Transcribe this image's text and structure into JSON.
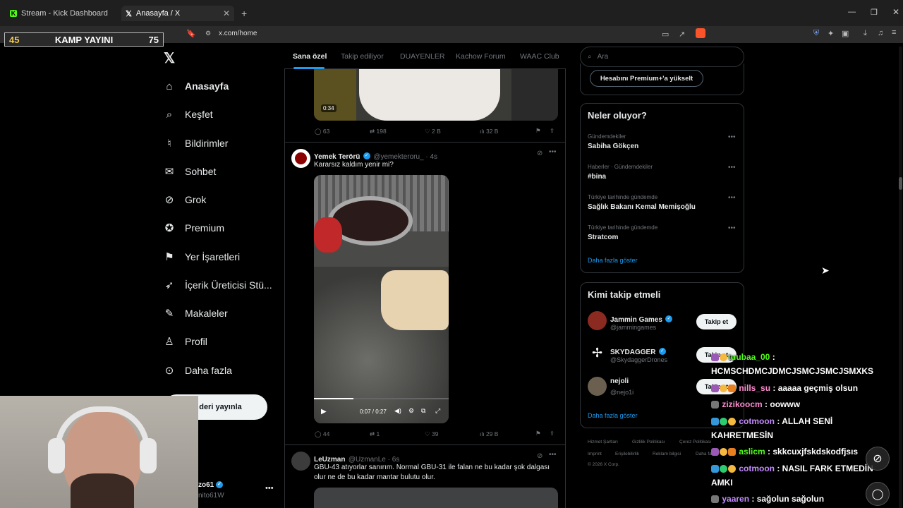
{
  "browser": {
    "tabs": [
      {
        "label": "Stream - Kick Dashboard",
        "active": false
      },
      {
        "label": "Anasayfa / X",
        "active": true
      }
    ],
    "url": "x.com/home"
  },
  "overlay": {
    "left_num": "45",
    "title": "KAMP YAYINI",
    "right_num": "75"
  },
  "sidebar": {
    "items": [
      {
        "label": "Anasayfa",
        "icon": "home-icon"
      },
      {
        "label": "Keşfet",
        "icon": "search-icon"
      },
      {
        "label": "Bildirimler",
        "icon": "bell-icon"
      },
      {
        "label": "Sohbet",
        "icon": "mail-icon"
      },
      {
        "label": "Grok",
        "icon": "grok-icon"
      },
      {
        "label": "Premium",
        "icon": "premium-icon"
      },
      {
        "label": "Yer İşaretleri",
        "icon": "bookmark-icon"
      },
      {
        "label": "İçerik Üreticisi Stü...",
        "icon": "rocket-icon"
      },
      {
        "label": "Makaleler",
        "icon": "article-icon"
      },
      {
        "label": "Profil",
        "icon": "profile-icon"
      },
      {
        "label": "Daha fazla",
        "icon": "more-icon"
      }
    ],
    "post_button": "deri yayınla",
    "account_name": "zo61",
    "account_handle": "nito61W"
  },
  "feed": {
    "tabs": [
      "Sana özel",
      "Takip ediliyor",
      "DUAYENLER",
      "Kachow Forum",
      "WAAC Club"
    ],
    "post0": {
      "duration": "0:34",
      "replies": "63",
      "reposts": "198",
      "likes": "2 B",
      "views": "32 B"
    },
    "post1": {
      "name": "Yemek Terörü",
      "handle": "@yemekteroru_ · 4s",
      "text": "Kararsız kaldım yenir mi?",
      "time": "0:07 / 0:27",
      "replies": "44",
      "reposts": "1",
      "likes": "39",
      "views": "29 B"
    },
    "post2": {
      "name": "LeUzman",
      "handle": "@UzmanLe · 6s",
      "text": "GBU-43 atıyorlar sanırım. Normal GBU-31 ile falan ne bu kadar şok dalgası olur ne de bu kadar mantar bulutu olur."
    }
  },
  "right": {
    "search_placeholder": "Ara",
    "premium_button": "Hesabını Premium+'a yükselt",
    "trends_title": "Neler oluyor?",
    "trends": [
      {
        "context": "Gündemdekiler",
        "name": "Sabiha Gökçen"
      },
      {
        "context": "Haberler · Gündemdekiler",
        "name": "#bina"
      },
      {
        "context": "Türkiye tarihinde gündemde",
        "name": "Sağlık Bakanı Kemal Memişoğlu"
      },
      {
        "context": "Türkiye tarihinde gündemde",
        "name": "Stratcom"
      }
    ],
    "show_more": "Daha fazla göster",
    "wtf_title": "Kimi takip etmeli",
    "wtf": [
      {
        "name": "Jammin Games",
        "handle": "@jammingames",
        "button": "Takip et"
      },
      {
        "name": "SKYDAGGER",
        "handle": "@SkydaggerDrones",
        "button": "Takip et"
      },
      {
        "name": "nejoli",
        "handle": "@nejo1i",
        "button": "Takip et"
      }
    ],
    "show_more2": "Daha fazla göster",
    "footer": [
      "Hizmet Şartları",
      "Gizlilik Politikası",
      "Çerez Politikası",
      "Imprint",
      "Erişilebilirlik",
      "Reklam bilgisi",
      "Daha fazla",
      "© 2026 X Corp."
    ]
  },
  "chat": [
    {
      "user": "tuubaa_00",
      "text": " :",
      "color": "green"
    },
    {
      "user": "",
      "text": "HCMSCHDMCJDMCJSMCJSMCJSMXKS",
      "color": "green"
    },
    {
      "user": "nills_su",
      "text": " : aaaaa geçmiş olsun",
      "color": "pink"
    },
    {
      "user": "zizikoocm",
      "text": " : oowww",
      "color": "pink"
    },
    {
      "user": "cotmoon",
      "text": " : ALLAH SENİ",
      "color": "purple"
    },
    {
      "user": "",
      "text": "KAHRETMESİN",
      "color": "purple"
    },
    {
      "user": "aslicm",
      "text": " : skkcuxjfskdskodfjsıs",
      "color": "green"
    },
    {
      "user": "cotmoon",
      "text": " : NASIL FARK ETMEDİN",
      "color": "purple"
    },
    {
      "user": "",
      "text": "AMKI",
      "color": "purple"
    },
    {
      "user": "yaaren",
      "text": " : sağolun sağolun",
      "color": "purple"
    }
  ]
}
